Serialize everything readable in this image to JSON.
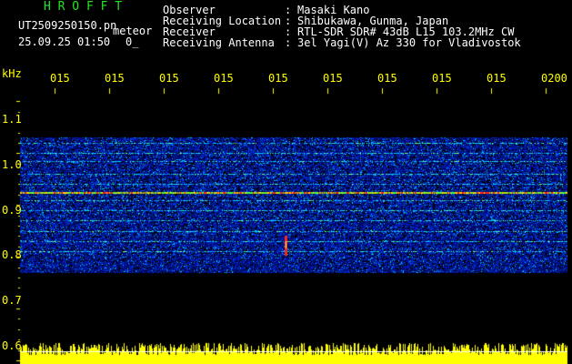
{
  "header": {
    "brand": "H R O F F T",
    "file_name": "UT2509250150.pn",
    "mode_label": "meteor",
    "date_time": "25.09.25 01:50",
    "count_label": "0_",
    "fields": [
      {
        "key": "Observer",
        "value": "Masaki Kano"
      },
      {
        "key": "Receiving Location",
        "value": "Shibukawa, Gunma, Japan"
      },
      {
        "key": "Receiver",
        "value": "RTL-SDR SDR# 43dB L15 103.2MHz CW"
      },
      {
        "key": "Receiving Antenna",
        "value": "3el Yagi(V) Az 330 for Vladivostok"
      }
    ]
  },
  "axis": {
    "unit": "kHz",
    "time_ticks": [
      "015",
      "015",
      "015",
      "015",
      "015",
      "015",
      "015",
      "015",
      "015",
      "0200"
    ],
    "freq_ticks": [
      {
        "label": "1.1",
        "value": 1.1
      },
      {
        "label": "1.0",
        "value": 1.0
      },
      {
        "label": "0.9",
        "value": 0.9
      },
      {
        "label": "0.8",
        "value": 0.8
      },
      {
        "label": "0.7",
        "value": 0.7
      },
      {
        "label": "0.6",
        "value": 0.6
      }
    ]
  },
  "colors": {
    "background": "#000000",
    "header_brand": "#22e622",
    "header_text": "#ffffff",
    "axis": "#ffff00",
    "band_low": "#0010a0",
    "band_mid": "#00c8ff",
    "band_high": "#ff2020",
    "level_bar": "#ffff00"
  },
  "spectrogram": {
    "freq_range_khz": [
      0.6,
      1.12
    ],
    "band_edges_khz": [
      0.77,
      1.03
    ],
    "meteor_trace_khz": 0.82,
    "carrier_khz": 0.925
  }
}
